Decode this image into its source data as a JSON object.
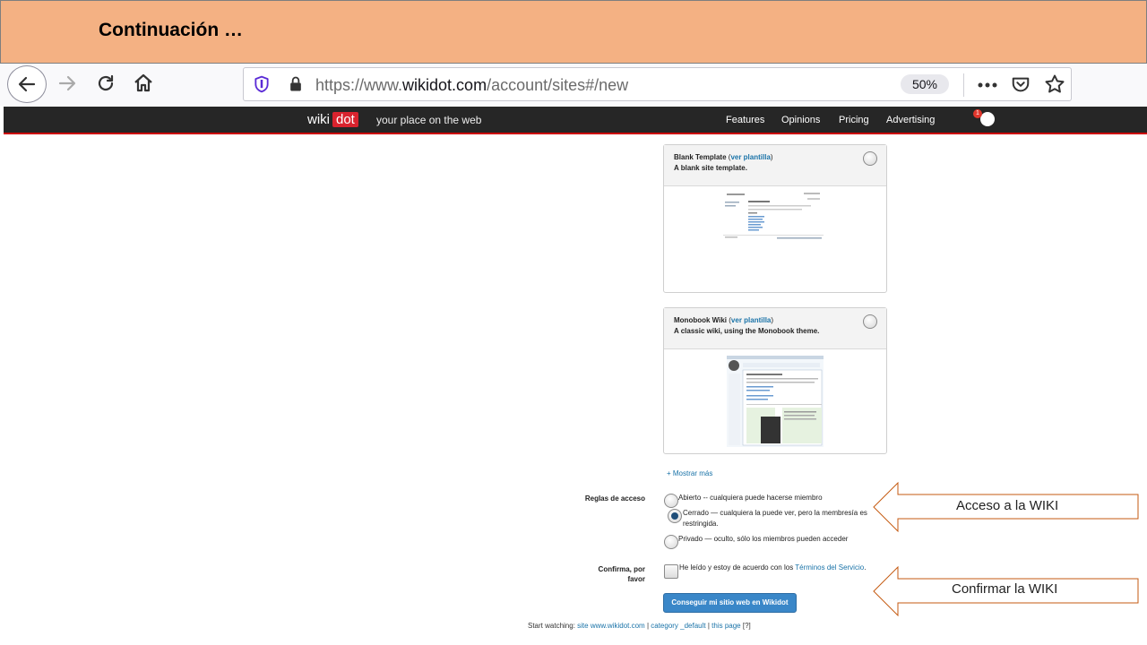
{
  "slide": {
    "title": "Continuación …"
  },
  "browser": {
    "url_prefix": "https://www.",
    "url_domain": "wikidot.com",
    "url_path": "/account/sites#/new",
    "zoom": "50%"
  },
  "wikidot": {
    "logo_left": "wiki",
    "logo_right": "dot",
    "tagline": "your place on the web",
    "nav": [
      "Features",
      "Opinions",
      "Pricing",
      "Advertising"
    ],
    "notification_count": "1"
  },
  "templates": [
    {
      "name": "Blank Template",
      "link": "ver plantilla",
      "description": "A blank site template."
    },
    {
      "name": "Monobook Wiki",
      "link": "ver plantilla",
      "description": "A classic wiki, using the Monobook theme."
    }
  ],
  "show_more": "+ Mostrar más",
  "access": {
    "label": "Reglas de acceso",
    "options": [
      "Abierto -- cualquiera puede hacerse miembro",
      "Cerrado — cualquiera la puede ver, pero la membresía es",
      "restringida.",
      "Privado — oculto, sólo los miembros pueden acceder"
    ]
  },
  "confirm": {
    "label_line1": "Confirma, por",
    "label_line2": "favor",
    "text": "He leído y estoy de acuerdo con los ",
    "tos_link": "Términos del Servicio",
    "text_end": "."
  },
  "submit_label": "Conseguir mi sitio web en Wikidot",
  "footer": {
    "prefix": "Start watching: ",
    "site": "site www.wikidot.com",
    "sep1": " | ",
    "category": "category _default",
    "sep2": " | ",
    "page": "this page",
    "help": " [?]"
  },
  "callouts": {
    "access": "Acceso a la WIKI",
    "confirm": "Confirmar la WIKI"
  }
}
